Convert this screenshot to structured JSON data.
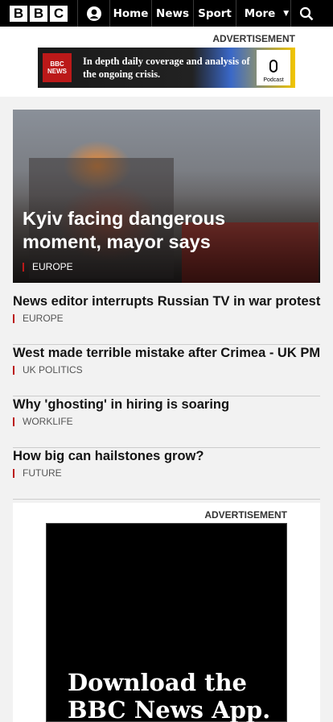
{
  "nav": {
    "logo_letters": [
      "B",
      "B",
      "C"
    ],
    "items": [
      "Home",
      "News",
      "Sport"
    ],
    "more_label": "More",
    "more_caret": "▼"
  },
  "ads": {
    "top_label": "ADVERTISEMENT",
    "banner_logo_top": "BBC",
    "banner_logo_bottom": "NEWS",
    "banner_text": "In depth daily coverage and analysis of the ongoing crisis.",
    "banner_badge": "Podcast",
    "bottom_label": "ADVERTISEMENT",
    "promo_line1": "Download the",
    "promo_line2": "BBC News App."
  },
  "hero": {
    "title": "Kyiv facing dangerous moment, mayor says",
    "tag": "EUROPE"
  },
  "stories": [
    {
      "title": "News editor interrupts Russian TV in war protest",
      "tag": "EUROPE"
    },
    {
      "title": "West made terrible mistake after Crimea - UK PM",
      "tag": "UK POLITICS"
    },
    {
      "title": "Why 'ghosting' in hiring is soaring",
      "tag": "WORKLIFE"
    },
    {
      "title": "How big can hailstones grow?",
      "tag": "FUTURE"
    }
  ],
  "colors": {
    "accent": "#bb1919",
    "nav_bg": "#000000",
    "page_bg": "#f2f2f2"
  }
}
